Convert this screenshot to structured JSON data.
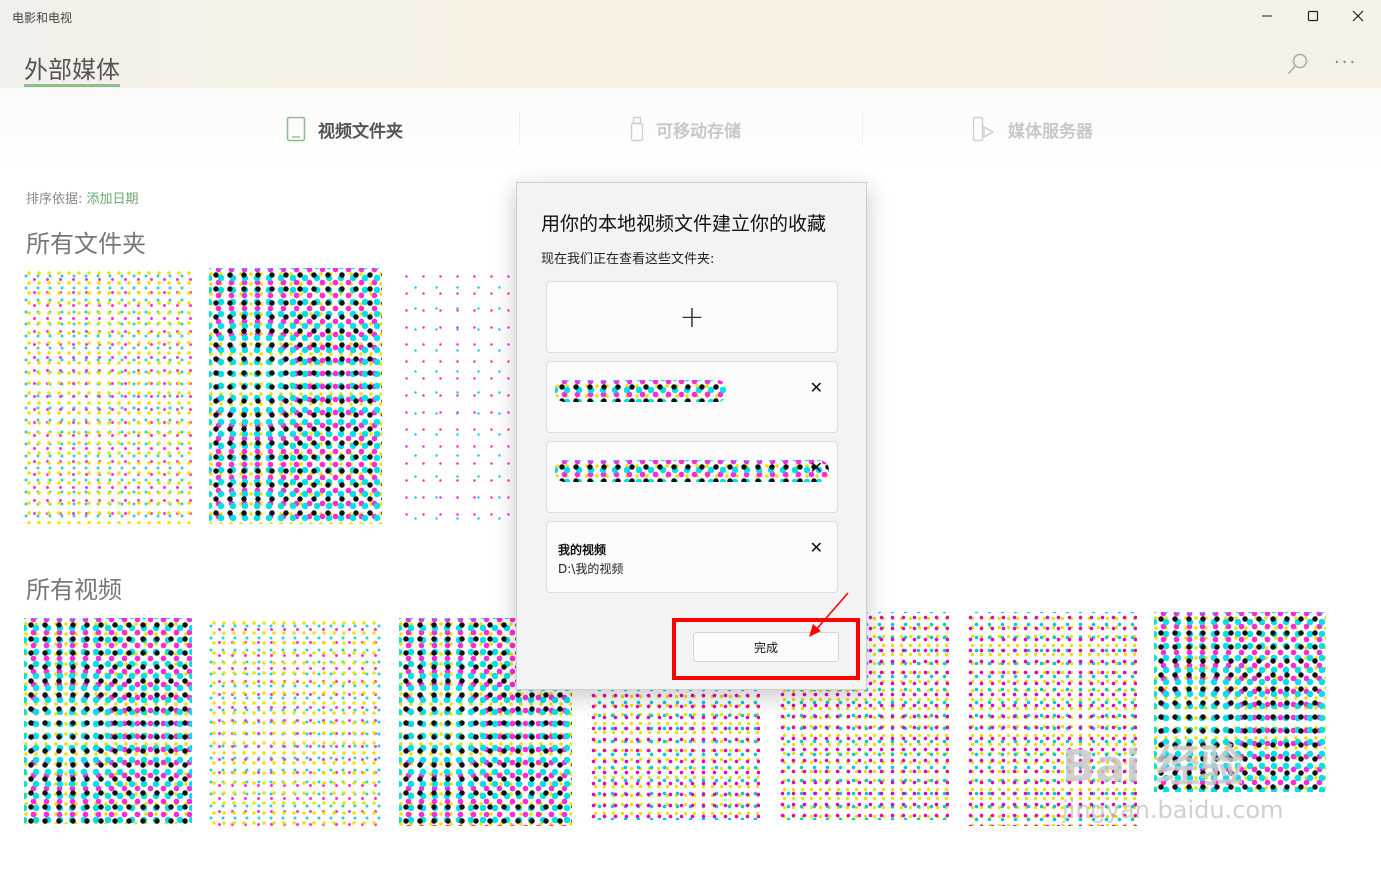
{
  "window": {
    "app_title": "电影和电视"
  },
  "header": {
    "page_title": "外部媒体"
  },
  "tabs": [
    {
      "label": "视频文件夹",
      "active": true,
      "icon": "folder-tablet-icon"
    },
    {
      "label": "可移动存储",
      "active": false,
      "icon": "usb-drive-icon"
    },
    {
      "label": "媒体服务器",
      "active": false,
      "icon": "media-server-icon"
    }
  ],
  "sort": {
    "label": "排序依据:",
    "value": "添加日期"
  },
  "sections": {
    "folders_title": "所有文件夹",
    "videos_title": "所有视频"
  },
  "dialog": {
    "title": "用你的本地视频文件建立你的收藏",
    "subtitle": "现在我们正在查看这些文件夹:",
    "add_glyph": "+",
    "remove_glyph": "✕",
    "folders": [
      {
        "name": "我的视频",
        "path": "D:\\我的视频"
      }
    ],
    "done_label": "完成"
  },
  "annotation": {
    "highlight_color": "#ff0000"
  },
  "watermark": {
    "logo": "Bai 经验",
    "url": "jingyan.baidu.com"
  },
  "colors": {
    "accent": "#6aa86a",
    "underline": "#8fbd8f"
  }
}
